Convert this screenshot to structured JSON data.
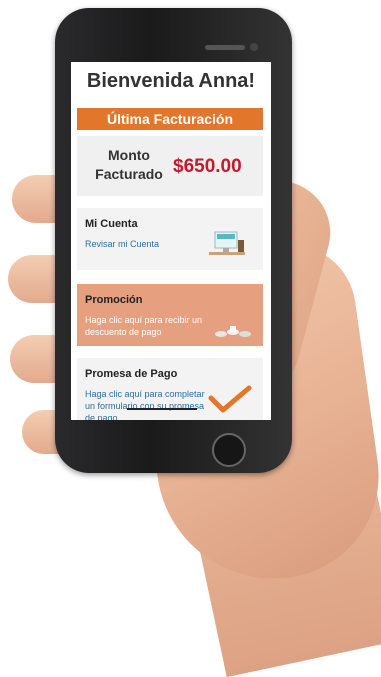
{
  "screen": {
    "welcome_title": "Bienvenida Anna!",
    "billing_bar": "Última Facturación",
    "amount_label": "Monto Facturado",
    "amount_value": "$650.00"
  },
  "cards": {
    "account": {
      "title": "Mi Cuenta",
      "link": "Revisar mi Cuenta",
      "icon": "computer-icon"
    },
    "promo": {
      "title": "Promoción",
      "link": "Haga clic aquí para recibir un descuento de pago",
      "icon": "coins-icon"
    },
    "promise": {
      "title": "Promesa de Pago",
      "link": "Haga clic aquí para completar un formulario con su promesa de pago",
      "icon": "check-icon"
    }
  },
  "colors": {
    "accent": "#e2772b",
    "amount": "#c7192c",
    "promo_bg": "#e69f7f",
    "link": "#2d6d9e"
  }
}
